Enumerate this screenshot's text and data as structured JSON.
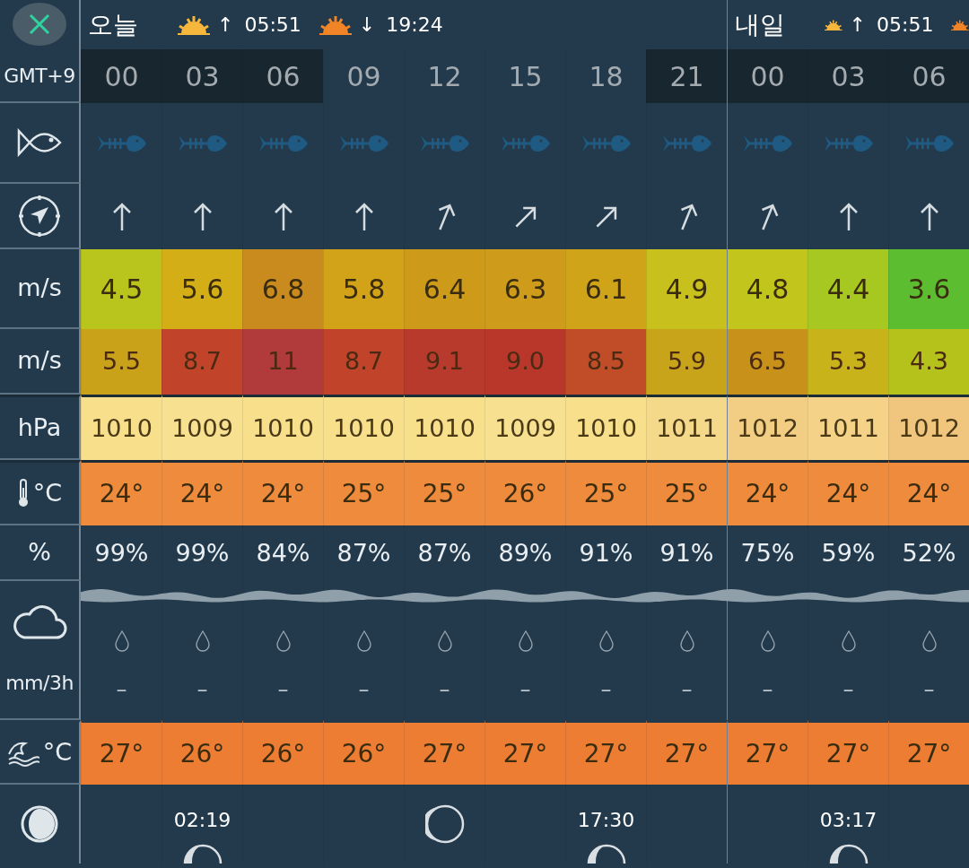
{
  "header": {
    "days": [
      {
        "label": "오늘",
        "events": [
          {
            "kind": "sunrise",
            "arrow": "↑",
            "time": "05:51"
          },
          {
            "kind": "sunset",
            "arrow": "↓",
            "time": "19:24"
          }
        ]
      },
      {
        "label": "내일",
        "events": [
          {
            "kind": "sunrise",
            "arrow": "↑",
            "time": "05:51"
          },
          {
            "kind": "sunset"
          }
        ]
      }
    ]
  },
  "labels": {
    "timezone": "GMT+9",
    "wind_unit": "m/s",
    "gust_unit": "m/s",
    "pressure_unit": "hPa",
    "temperature_unit": "°C",
    "humidity_unit": "%",
    "rain_unit": "mm/3h",
    "sea_temperature_unit": "°C"
  },
  "columns": [
    {
      "time": "00",
      "night": true,
      "day_start": false,
      "wind_arrow": {
        "kind": "north"
      },
      "wind": {
        "value": "4.5",
        "color": "#b9c41c"
      },
      "gust": {
        "value": "5.5",
        "color": "#c9a21a"
      },
      "pressure": {
        "value": "1010",
        "color": "#f7df8c"
      },
      "temperature": "24°",
      "humidity": "99%",
      "rain": "–",
      "sea_temperature": "27°",
      "moon": {
        "kind": "none"
      }
    },
    {
      "time": "03",
      "night": true,
      "day_start": false,
      "wind_arrow": {
        "kind": "north"
      },
      "wind": {
        "value": "5.6",
        "color": "#d4ae16"
      },
      "gust": {
        "value": "8.7",
        "color": "#c0432a"
      },
      "pressure": {
        "value": "1009",
        "color": "#f7e090"
      },
      "temperature": "24°",
      "humidity": "99%",
      "rain": "–",
      "sea_temperature": "26°",
      "moon": {
        "kind": "rise",
        "time": "02:19"
      }
    },
    {
      "time": "06",
      "night": true,
      "day_start": false,
      "wind_arrow": {
        "kind": "north"
      },
      "wind": {
        "value": "6.8",
        "color": "#c98a1e"
      },
      "gust": {
        "value": "11",
        "color": "#b13a3a"
      },
      "pressure": {
        "value": "1010",
        "color": "#f7df8c"
      },
      "temperature": "24°",
      "humidity": "84%",
      "rain": "–",
      "sea_temperature": "26°",
      "moon": {
        "kind": "none"
      }
    },
    {
      "time": "09",
      "night": false,
      "day_start": false,
      "wind_arrow": {
        "kind": "north"
      },
      "wind": {
        "value": "5.8",
        "color": "#d2a218"
      },
      "gust": {
        "value": "8.7",
        "color": "#c0432a"
      },
      "pressure": {
        "value": "1010",
        "color": "#f7df8c"
      },
      "temperature": "25°",
      "humidity": "87%",
      "rain": "–",
      "sea_temperature": "26°",
      "moon": {
        "kind": "none"
      }
    },
    {
      "time": "12",
      "night": false,
      "day_start": false,
      "wind_arrow": {
        "kind": "northnortheast"
      },
      "wind": {
        "value": "6.4",
        "color": "#cd9a1a"
      },
      "gust": {
        "value": "9.1",
        "color": "#b83a2c"
      },
      "pressure": {
        "value": "1010",
        "color": "#f7df8c"
      },
      "temperature": "25°",
      "humidity": "87%",
      "rain": "–",
      "sea_temperature": "27°",
      "moon": {
        "kind": "phase"
      }
    },
    {
      "time": "15",
      "night": false,
      "day_start": false,
      "wind_arrow": {
        "kind": "northeast"
      },
      "wind": {
        "value": "6.3",
        "color": "#ce9c1a"
      },
      "gust": {
        "value": "9.0",
        "color": "#b8362a"
      },
      "pressure": {
        "value": "1009",
        "color": "#f7e090"
      },
      "temperature": "26°",
      "humidity": "89%",
      "rain": "–",
      "sea_temperature": "27°",
      "moon": {
        "kind": "none"
      }
    },
    {
      "time": "18",
      "night": false,
      "day_start": false,
      "wind_arrow": {
        "kind": "northeast"
      },
      "wind": {
        "value": "6.1",
        "color": "#d0a418"
      },
      "gust": {
        "value": "8.5",
        "color": "#c04c28"
      },
      "pressure": {
        "value": "1010",
        "color": "#f7df8c"
      },
      "temperature": "25°",
      "humidity": "91%",
      "rain": "–",
      "sea_temperature": "27°",
      "moon": {
        "kind": "rise",
        "time": "17:30"
      }
    },
    {
      "time": "21",
      "night": true,
      "day_start": false,
      "wind_arrow": {
        "kind": "northnortheast"
      },
      "wind": {
        "value": "4.9",
        "color": "#c8c01c"
      },
      "gust": {
        "value": "5.9",
        "color": "#c8a41a"
      },
      "pressure": {
        "value": "1011",
        "color": "#f5d98a"
      },
      "temperature": "25°",
      "humidity": "91%",
      "rain": "–",
      "sea_temperature": "27°",
      "moon": {
        "kind": "none"
      }
    },
    {
      "time": "00",
      "night": true,
      "day_start": true,
      "wind_arrow": {
        "kind": "northnortheast"
      },
      "wind": {
        "value": "4.8",
        "color": "#c2c61c"
      },
      "gust": {
        "value": "6.5",
        "color": "#c8921a"
      },
      "pressure": {
        "value": "1012",
        "color": "#f2cd84"
      },
      "temperature": "24°",
      "humidity": "75%",
      "rain": "–",
      "sea_temperature": "27°",
      "moon": {
        "kind": "none"
      }
    },
    {
      "time": "03",
      "night": true,
      "day_start": false,
      "wind_arrow": {
        "kind": "north"
      },
      "wind": {
        "value": "4.4",
        "color": "#a6c820"
      },
      "gust": {
        "value": "5.3",
        "color": "#c8b41a"
      },
      "pressure": {
        "value": "1011",
        "color": "#f4d388"
      },
      "temperature": "24°",
      "humidity": "59%",
      "rain": "–",
      "sea_temperature": "27°",
      "moon": {
        "kind": "rise",
        "time": "03:17"
      }
    },
    {
      "time": "06",
      "night": true,
      "day_start": false,
      "wind_arrow": {
        "kind": "north"
      },
      "wind": {
        "value": "3.6",
        "color": "#5cbd30"
      },
      "gust": {
        "value": "4.3",
        "color": "#b6c21c"
      },
      "pressure": {
        "value": "1012",
        "color": "#f0c67e"
      },
      "temperature": "24°",
      "humidity": "52%",
      "rain": "–",
      "sea_temperature": "27°",
      "moon": {
        "kind": "none"
      }
    }
  ]
}
